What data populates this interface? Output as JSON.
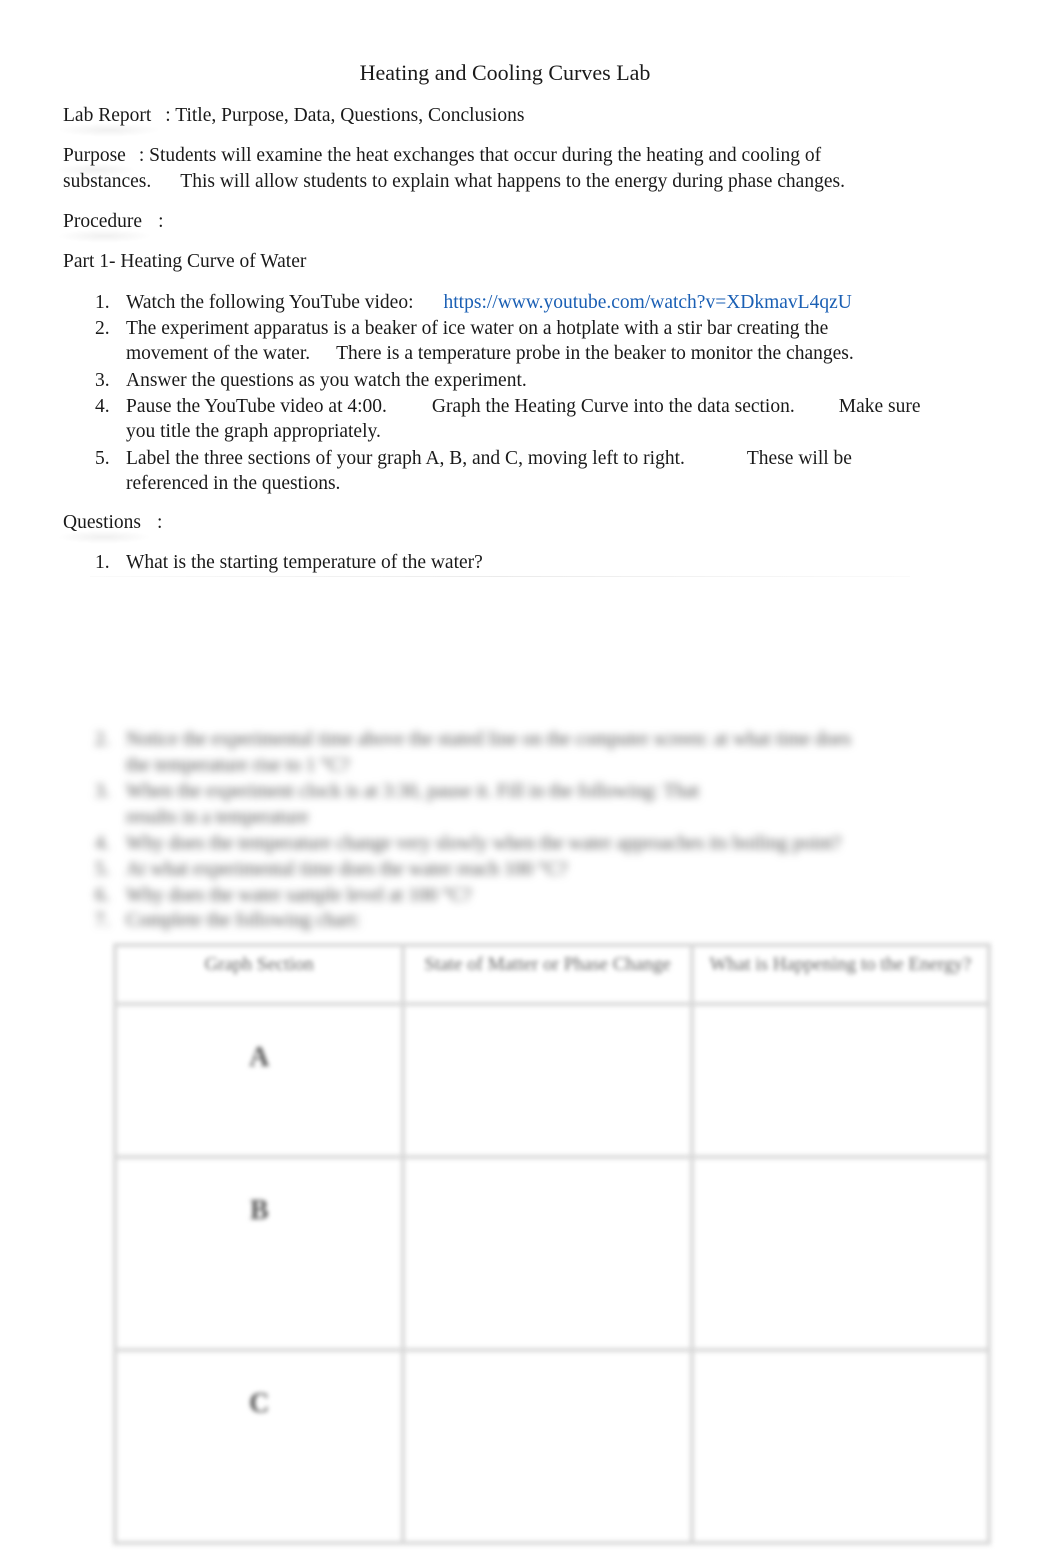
{
  "document": {
    "title": "Heating and Cooling Curves Lab",
    "lab_report": {
      "label": "Lab Report",
      "separator": ":",
      "value": "Title, Purpose, Data, Questions, Conclusions"
    },
    "purpose": {
      "label": "Purpose",
      "separator": ":",
      "line1": "Students will examine the heat exchanges that occur during the heating and cooling of",
      "line2a": "substances.",
      "line2b": "This will allow students to explain what happens to the energy during phase changes."
    },
    "procedure": {
      "label": "Procedure",
      "separator": ":"
    },
    "part1": {
      "heading": "Part 1- Heating Curve of Water",
      "steps": [
        {
          "num": "1.",
          "text": "Watch the following YouTube video:",
          "link": "https://www.youtube.com/watch?v=XDkmavL4qzU"
        },
        {
          "num": "2.",
          "line1": "The experiment apparatus is a beaker of ice water on a hotplate with a stir bar creating the",
          "line2a": "movement of the water.",
          "line2b": "There is a temperature probe in the beaker to monitor the changes."
        },
        {
          "num": "3.",
          "text": "Answer the questions as you watch the experiment."
        },
        {
          "num": "4.",
          "line1a": "Pause the YouTube video at 4:00.",
          "line1b": "Graph the Heating Curve into the data section.",
          "line1c": "Make sure",
          "line2": "you title the graph appropriately."
        },
        {
          "num": "5.",
          "line1a": "Label the three sections of your graph A, B, and C, moving left to right.",
          "line1b": "These will be",
          "line2": "referenced in the questions."
        }
      ]
    },
    "questions": {
      "label": "Questions",
      "separator": ":",
      "items": [
        {
          "num": "1.",
          "text": "What is the starting temperature of the water?"
        },
        {
          "num": "2.",
          "line1": "Notice the experimental time above the stated line on the computer screen: at what time does",
          "line2": "the temperature rise to 1 °C?"
        },
        {
          "num": "3.",
          "line1": "When the experiment clock is at 3:30, pause it. Fill in the following: That",
          "line2": "results in a temperature"
        },
        {
          "num": "4.",
          "text": "Why does the temperature change very slowly when the water approaches its boiling point?"
        },
        {
          "num": "5.",
          "text": "At what experimental time does the water reach 100 °C?"
        },
        {
          "num": "6.",
          "text": "Why does the water sample level at 100 °C?"
        },
        {
          "num": "7.",
          "text": "Complete the following chart:"
        }
      ]
    },
    "chart_table": {
      "headers": [
        "Graph Section",
        "State of Matter or Phase Change",
        "What is Happening to the Energy?"
      ],
      "rows": [
        {
          "section": "A",
          "state": "",
          "energy": ""
        },
        {
          "section": "B",
          "state": "",
          "energy": ""
        },
        {
          "section": "C",
          "state": "",
          "energy": ""
        }
      ]
    }
  }
}
